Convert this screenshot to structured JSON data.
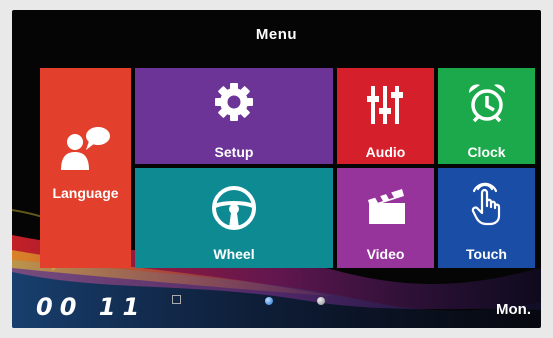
{
  "header": {
    "title": "Menu"
  },
  "tiles": {
    "language": {
      "label": "Language",
      "color": "#e2402c",
      "icon": "person-speech-icon"
    },
    "setup": {
      "label": "Setup",
      "color": "#6b3496",
      "icon": "gear-icon"
    },
    "audio": {
      "label": "Audio",
      "color": "#d51f2a",
      "icon": "equalizer-icon"
    },
    "clock": {
      "label": "Clock",
      "color": "#1ba94b",
      "icon": "alarm-clock-icon"
    },
    "wheel": {
      "label": "Wheel",
      "color": "#0d8a92",
      "icon": "steering-wheel-icon"
    },
    "video": {
      "label": "Video",
      "color": "#96349c",
      "icon": "clapperboard-icon"
    },
    "touch": {
      "label": "Touch",
      "color": "#1a4ea6",
      "icon": "touch-hand-icon"
    }
  },
  "status": {
    "time": "00 11",
    "day": "Mon.",
    "indicators": [
      "sd-card-icon",
      "blue-dot-indicator",
      "grey-dot-indicator"
    ]
  }
}
